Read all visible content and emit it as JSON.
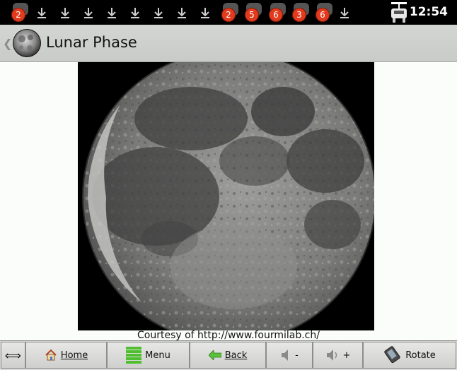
{
  "status_bar": {
    "time": "12:54",
    "badges": [
      "2",
      "2",
      "5",
      "6",
      "3",
      "6"
    ]
  },
  "title_bar": {
    "title": "Lunar Phase",
    "back_glyph": "❮"
  },
  "main": {
    "image_name": "moon-image",
    "caption": "Courtesy of http://www.fourmilab.ch/"
  },
  "toolbar": {
    "resize_glyph": "⟺",
    "home_label": "Home",
    "menu_label": "Menu",
    "back_label": "Back",
    "vol_down_label": "-",
    "vol_up_label": "+",
    "rotate_label": "Rotate"
  },
  "colors": {
    "badge": "#e23a1c",
    "titlebar": "#d3d6d3",
    "status_bar": "#000000"
  }
}
